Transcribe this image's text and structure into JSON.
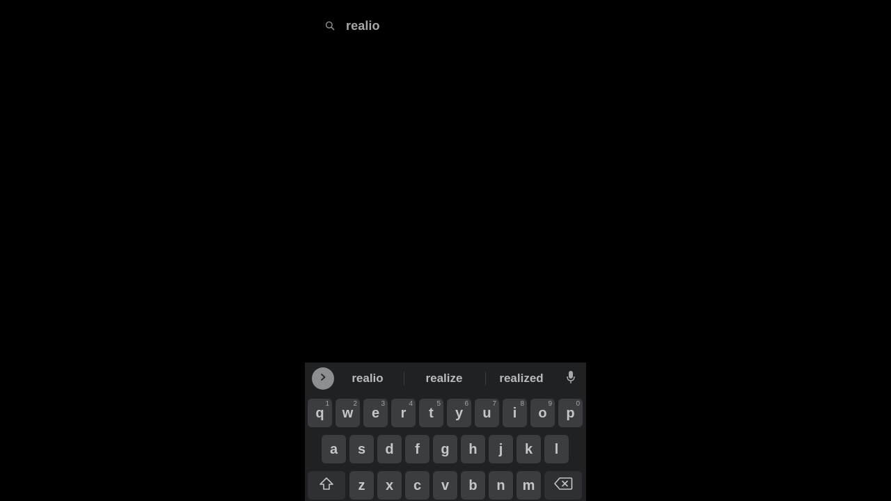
{
  "search": {
    "icon": "search-icon",
    "query": "realio"
  },
  "keyboard": {
    "expand_icon": "chevron-right-icon",
    "suggestions": [
      "realio",
      "realize",
      "realized"
    ],
    "mic_icon": "microphone-icon",
    "row1": [
      {
        "char": "q",
        "hint": "1"
      },
      {
        "char": "w",
        "hint": "2"
      },
      {
        "char": "e",
        "hint": "3"
      },
      {
        "char": "r",
        "hint": "4"
      },
      {
        "char": "t",
        "hint": "5"
      },
      {
        "char": "y",
        "hint": "6"
      },
      {
        "char": "u",
        "hint": "7"
      },
      {
        "char": "i",
        "hint": "8"
      },
      {
        "char": "o",
        "hint": "9"
      },
      {
        "char": "p",
        "hint": "0"
      }
    ],
    "row2": [
      "a",
      "s",
      "d",
      "f",
      "g",
      "h",
      "j",
      "k",
      "l"
    ],
    "row3": [
      "z",
      "x",
      "c",
      "v",
      "b",
      "n",
      "m"
    ],
    "shift_icon": "shift-icon",
    "backspace_icon": "backspace-icon",
    "colors": {
      "background": "#1f2123",
      "key": "#3b3d40",
      "key_text": "#c4c6c8",
      "expand_button": "#8c8e90"
    }
  }
}
